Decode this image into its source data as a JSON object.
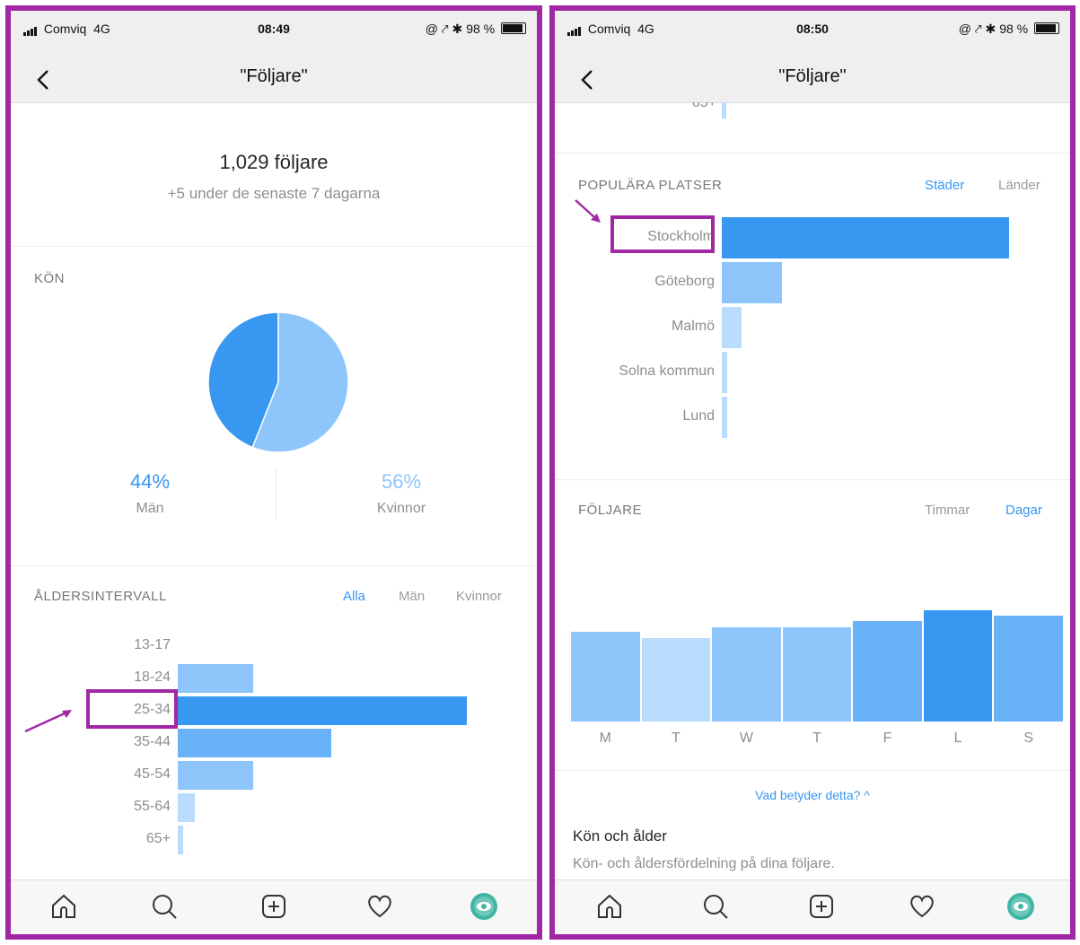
{
  "colors": {
    "frame": "#a128a4",
    "blue": "#3897f0",
    "light_blue": "#8ec5fb",
    "lighter_blue": "#b9dcff",
    "mid_blue": "#6ab2f7"
  },
  "left": {
    "status": {
      "carrier": "Comviq",
      "network": "4G",
      "time": "08:49",
      "battery": "98 %"
    },
    "nav_title": "\"Följare\"",
    "followers_count": "1,029 följare",
    "followers_change": "+5 under de senaste 7 dagarna",
    "gender": {
      "heading": "KÖN",
      "men_pct": "44%",
      "men_label": "Män",
      "women_pct": "56%",
      "women_label": "Kvinnor"
    },
    "age": {
      "heading": "ÅLDERSINTERVALL",
      "tabs": [
        "Alla",
        "Män",
        "Kvinnor"
      ]
    }
  },
  "right": {
    "status": {
      "carrier": "Comviq",
      "network": "4G",
      "time": "08:50",
      "battery": "98 %"
    },
    "nav_title": "\"Följare\"",
    "top_cut_label": "65+",
    "places": {
      "heading": "POPULÄRA PLATSER",
      "tabs": [
        "Städer",
        "Länder"
      ]
    },
    "followers": {
      "heading": "FÖLJARE",
      "tabs": [
        "Timmar",
        "Dagar"
      ]
    },
    "help_link": "Vad betyder detta? ^",
    "info_title": "Kön och ålder",
    "info_text": "Kön- och åldersfördelning på dina följare."
  },
  "chart_data": [
    {
      "type": "pie",
      "title": "KÖN",
      "categories": [
        "Män",
        "Kvinnor"
      ],
      "values": [
        44,
        56
      ],
      "colors": [
        "#3897f0",
        "#8ec5fb"
      ]
    },
    {
      "type": "bar",
      "orientation": "horizontal",
      "title": "ÅLDERSINTERVALL",
      "categories": [
        "13-17",
        "18-24",
        "25-34",
        "35-44",
        "45-54",
        "55-64",
        "65+"
      ],
      "values": [
        0,
        26,
        100,
        53,
        26,
        6,
        2
      ],
      "highlight": "25-34"
    },
    {
      "type": "bar",
      "orientation": "horizontal",
      "title": "POPULÄRA PLATSER",
      "categories": [
        "Stockholm",
        "Göteborg",
        "Malmö",
        "Solna kommun",
        "Lund"
      ],
      "values": [
        100,
        21,
        7,
        2,
        2
      ],
      "highlight": "Stockholm"
    },
    {
      "type": "bar",
      "title": "FÖLJARE",
      "categories": [
        "M",
        "T",
        "W",
        "T",
        "F",
        "L",
        "S"
      ],
      "values": [
        81,
        75,
        85,
        85,
        90,
        100,
        95
      ]
    }
  ]
}
